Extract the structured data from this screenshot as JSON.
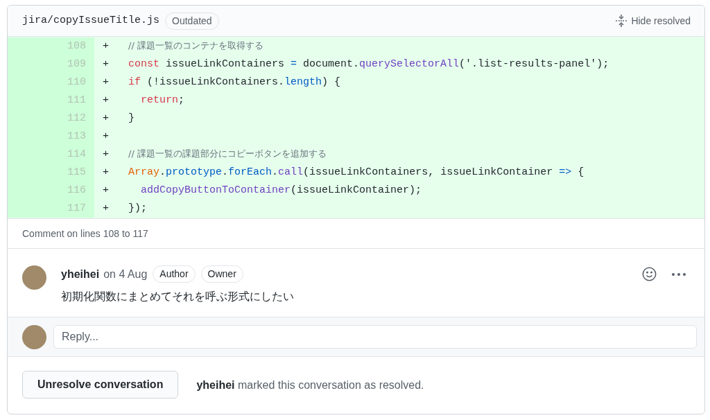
{
  "file": {
    "path": "jira/copyIssueTitle.js",
    "badge": "Outdated",
    "hide_label": "Hide resolved"
  },
  "lines": [
    {
      "number": "108",
      "sign": "+",
      "tokens": [
        {
          "kind": "comment",
          "text": "// 課題一覧のコンテナを取得する"
        }
      ]
    },
    {
      "number": "109",
      "sign": "+",
      "tokens": [
        {
          "kind": "keyword",
          "text": "const"
        },
        {
          "kind": "plain",
          "text": " issueLinkContainers "
        },
        {
          "kind": "operator",
          "text": "="
        },
        {
          "kind": "plain",
          "text": " document."
        },
        {
          "kind": "method",
          "text": "querySelectorAll"
        },
        {
          "kind": "plain",
          "text": "('.list-results-panel');"
        }
      ]
    },
    {
      "number": "110",
      "sign": "+",
      "tokens": [
        {
          "kind": "keyword",
          "text": "if"
        },
        {
          "kind": "plain",
          "text": " (!issueLinkContainers."
        },
        {
          "kind": "property",
          "text": "length"
        },
        {
          "kind": "plain",
          "text": ") {"
        }
      ]
    },
    {
      "number": "111",
      "sign": "+",
      "indented": true,
      "tokens": [
        {
          "kind": "keyword",
          "text": "return"
        },
        {
          "kind": "plain",
          "text": ";"
        }
      ]
    },
    {
      "number": "112",
      "sign": "+",
      "tokens": [
        {
          "kind": "plain",
          "text": "}"
        }
      ]
    },
    {
      "number": "113",
      "sign": "+"
    },
    {
      "number": "114",
      "sign": "+",
      "tokens": [
        {
          "kind": "comment",
          "text": "// 課題一覧の課題部分にコピーボタンを追加する"
        }
      ]
    },
    {
      "number": "115",
      "sign": "+",
      "tokens": [
        {
          "kind": "builtin",
          "text": "Array"
        },
        {
          "kind": "plain",
          "text": "."
        },
        {
          "kind": "property",
          "text": "prototype"
        },
        {
          "kind": "plain",
          "text": "."
        },
        {
          "kind": "property",
          "text": "forEach"
        },
        {
          "kind": "plain",
          "text": "."
        },
        {
          "kind": "method",
          "text": "call"
        },
        {
          "kind": "plain",
          "text": "(issueLinkContainers, issueLinkContainer "
        },
        {
          "kind": "operator",
          "text": "=>"
        },
        {
          "kind": "plain",
          "text": " {"
        }
      ]
    },
    {
      "number": "116",
      "sign": "+",
      "indented": true,
      "tokens": [
        {
          "kind": "method",
          "text": "addCopyButtonToContainer"
        },
        {
          "kind": "plain",
          "text": "(issueLinkContainer);"
        }
      ]
    },
    {
      "number": "117",
      "sign": "+",
      "tokens": [
        {
          "kind": "plain",
          "text": "});"
        }
      ]
    }
  ],
  "comment_range": "Comment on lines 108 to 117",
  "comment": {
    "author": "yheihei",
    "date": "on 4 Aug",
    "badges": [
      "Author",
      "Owner"
    ],
    "body": "初期化関数にまとめてそれを呼ぶ形式にしたい"
  },
  "reply": {
    "placeholder": "Reply..."
  },
  "footer": {
    "button": "Unresolve conversation",
    "status": "**yheihei** marked this conversation as resolved."
  }
}
